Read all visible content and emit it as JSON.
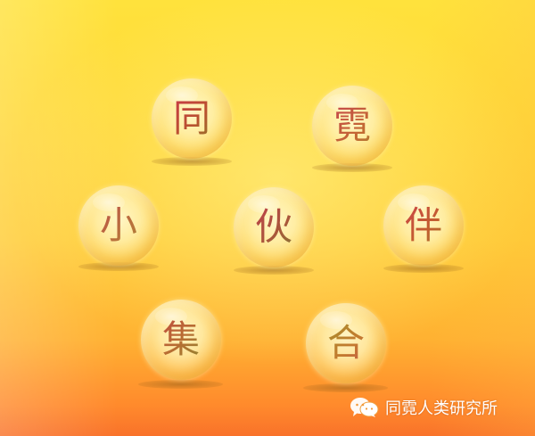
{
  "bubbles": [
    {
      "id": "tong",
      "char": "同"
    },
    {
      "id": "ni",
      "char": "霓"
    },
    {
      "id": "xiao",
      "char": "小"
    },
    {
      "id": "huo",
      "char": "伙"
    },
    {
      "id": "ban",
      "char": "伴"
    },
    {
      "id": "ji",
      "char": "集"
    },
    {
      "id": "he",
      "char": "合"
    }
  ],
  "watermark": {
    "icon": "wechat-icon",
    "text": "同霓人类研究所"
  }
}
